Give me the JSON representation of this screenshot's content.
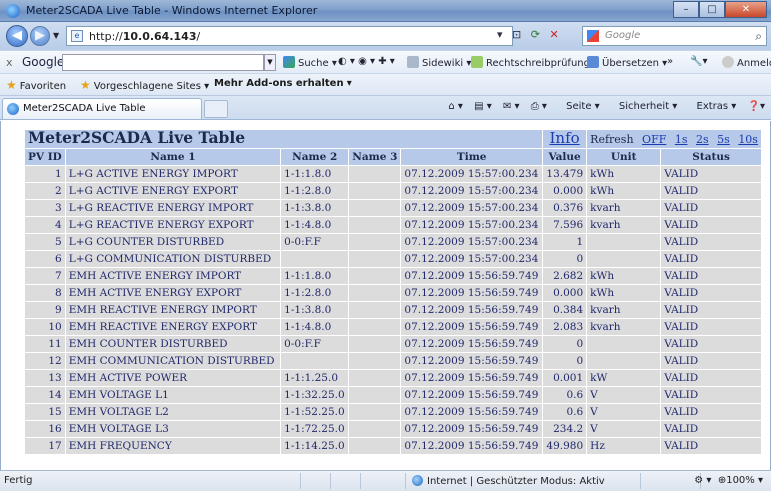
{
  "window": {
    "title": "Meter2SCADA Live Table - Windows Internet Explorer",
    "buttons": {
      "minimize": "–",
      "maximize": "□",
      "close": "✕"
    }
  },
  "address_bar": {
    "url_prefix": "http://",
    "url_host": "10.0.64.143",
    "url_suffix": "/",
    "search_placeholder": "Google"
  },
  "google_toolbar": {
    "close": "x",
    "brand": "Google",
    "items": [
      "Suche",
      "Sidewiki",
      "Rechtschreibprüfung",
      "Übersetzen",
      "»"
    ],
    "signin": "Anmelden"
  },
  "favorites_bar": {
    "favorites": "Favoriten",
    "suggested": "Vorgeschlagene Sites",
    "addons": "Mehr Add-ons erhalten"
  },
  "tab": {
    "label": "Meter2SCADA Live Table"
  },
  "command_bar": {
    "page": "Seite",
    "safety": "Sicherheit",
    "extras": "Extras"
  },
  "page": {
    "title": "Meter2SCADA Live Table",
    "info_link": "Info",
    "refresh_label": "Refresh",
    "refresh_options": [
      "OFF",
      "1s",
      "2s",
      "5s",
      "10s"
    ],
    "columns": [
      "PV ID",
      "Name 1",
      "Name 2",
      "Name 3",
      "Time",
      "Value",
      "Unit",
      "Status"
    ],
    "rows": [
      [
        "1",
        "L+G ACTIVE ENERGY IMPORT",
        "1-1:1.8.0",
        "",
        "07.12.2009 15:57:00.234",
        "13.479",
        "kWh",
        "VALID"
      ],
      [
        "2",
        "L+G ACTIVE ENERGY EXPORT",
        "1-1:2.8.0",
        "",
        "07.12.2009 15:57:00.234",
        "0.000",
        "kWh",
        "VALID"
      ],
      [
        "3",
        "L+G REACTIVE ENERGY IMPORT",
        "1-1:3.8.0",
        "",
        "07.12.2009 15:57:00.234",
        "0.376",
        "kvarh",
        "VALID"
      ],
      [
        "4",
        "L+G REACTIVE ENERGY EXPORT",
        "1-1:4.8.0",
        "",
        "07.12.2009 15:57:00.234",
        "7.596",
        "kvarh",
        "VALID"
      ],
      [
        "5",
        "L+G COUNTER DISTURBED",
        "0-0:F.F",
        "",
        "07.12.2009 15:57:00.234",
        "1",
        "",
        "VALID"
      ],
      [
        "6",
        "L+G COMMUNICATION DISTURBED",
        "",
        "",
        "07.12.2009 15:57:00.234",
        "0",
        "",
        "VALID"
      ],
      [
        "7",
        "EMH ACTIVE ENERGY IMPORT",
        "1-1:1.8.0",
        "",
        "07.12.2009 15:56:59.749",
        "2.682",
        "kWh",
        "VALID"
      ],
      [
        "8",
        "EMH ACTIVE ENERGY EXPORT",
        "1-1:2.8.0",
        "",
        "07.12.2009 15:56:59.749",
        "0.000",
        "kWh",
        "VALID"
      ],
      [
        "9",
        "EMH REACTIVE ENERGY IMPORT",
        "1-1:3.8.0",
        "",
        "07.12.2009 15:56:59.749",
        "0.384",
        "kvarh",
        "VALID"
      ],
      [
        "10",
        "EMH REACTIVE ENERGY EXPORT",
        "1-1:4.8.0",
        "",
        "07.12.2009 15:56:59.749",
        "2.083",
        "kvarh",
        "VALID"
      ],
      [
        "11",
        "EMH COUNTER DISTURBED",
        "0-0:F.F",
        "",
        "07.12.2009 15:56:59.749",
        "0",
        "",
        "VALID"
      ],
      [
        "12",
        "EMH COMMUNICATION DISTURBED",
        "",
        "",
        "07.12.2009 15:56:59.749",
        "0",
        "",
        "VALID"
      ],
      [
        "13",
        "EMH ACTIVE POWER",
        "1-1:1.25.0",
        "",
        "07.12.2009 15:56:59.749",
        "0.001",
        "kW",
        "VALID"
      ],
      [
        "14",
        "EMH VOLTAGE L1",
        "1-1:32.25.0",
        "",
        "07.12.2009 15:56:59.749",
        "0.6",
        "V",
        "VALID"
      ],
      [
        "15",
        "EMH VOLTAGE L2",
        "1-1:52.25.0",
        "",
        "07.12.2009 15:56:59.749",
        "0.6",
        "V",
        "VALID"
      ],
      [
        "16",
        "EMH VOLTAGE L3",
        "1-1:72.25.0",
        "",
        "07.12.2009 15:56:59.749",
        "234.2",
        "V",
        "VALID"
      ],
      [
        "17",
        "EMH FREQUENCY",
        "1-1:14.25.0",
        "",
        "07.12.2009 15:56:59.749",
        "49.980",
        "Hz",
        "VALID"
      ]
    ]
  },
  "status_bar": {
    "status": "Fertig",
    "zone": "Internet | Geschützter Modus: Aktiv",
    "zoom": "100%"
  },
  "colors": {
    "header_bg": "#b7c9e8",
    "row_bg": "#dcdcdc",
    "row_text": "#20286a",
    "link": "#1a3cb0"
  }
}
